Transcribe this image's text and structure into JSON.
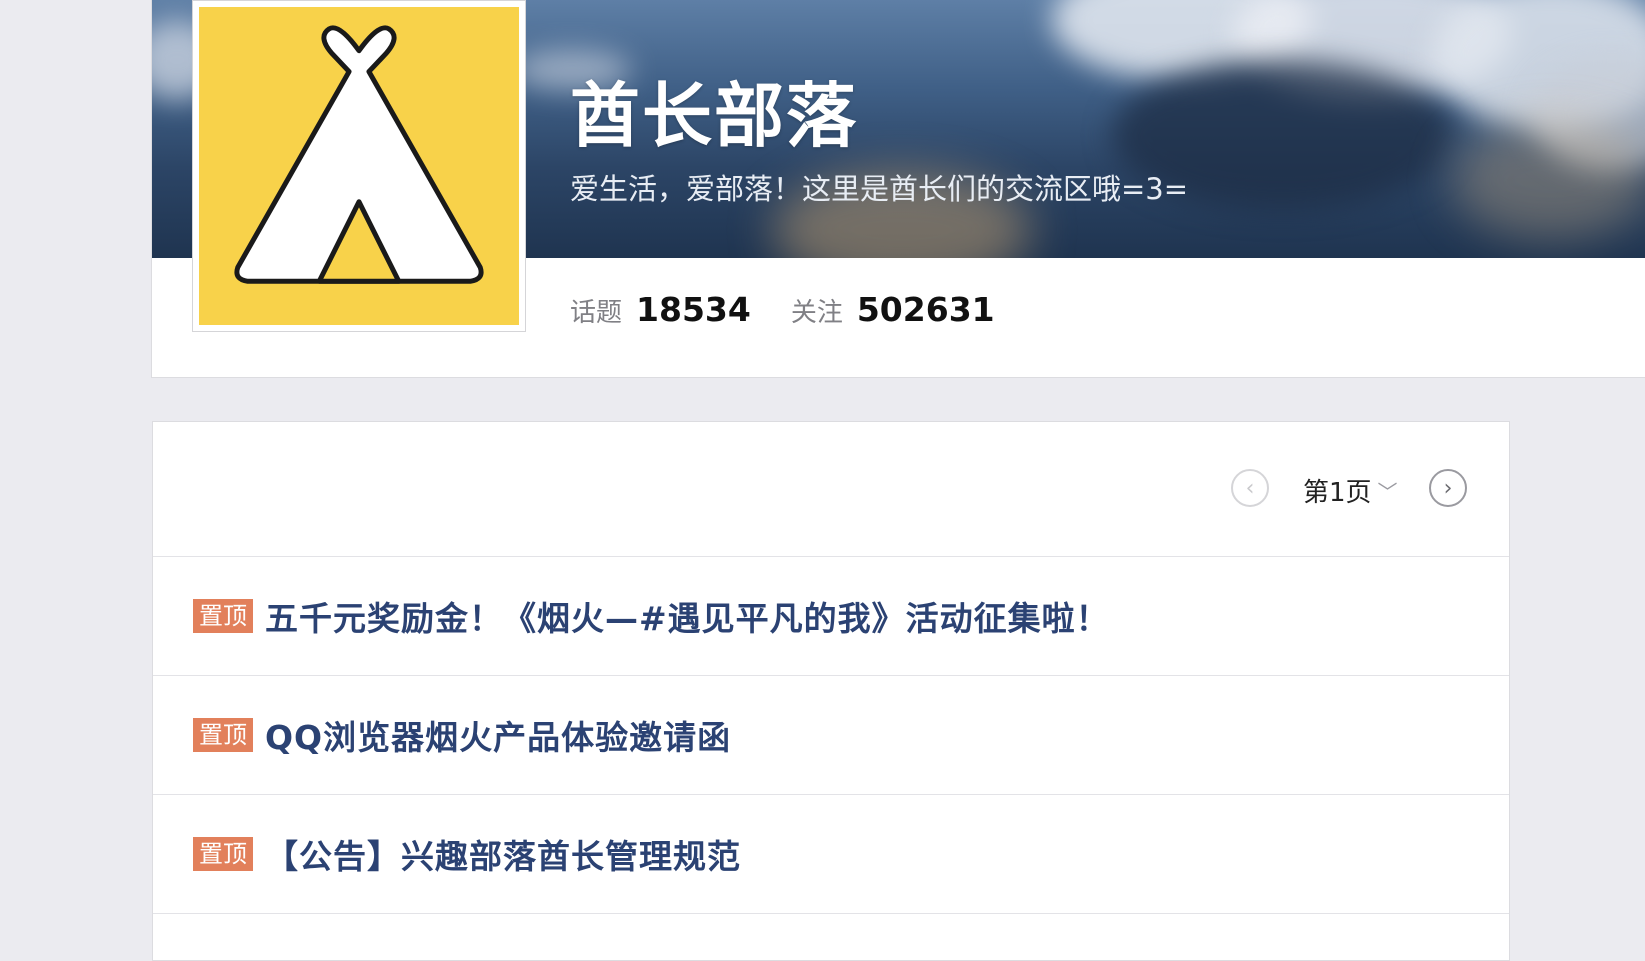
{
  "tribe": {
    "name": "酋长部落",
    "description": "爱生活，爱部落！这里是酋长们的交流区哦=3=",
    "stats": [
      {
        "label": "话题",
        "value": "18534"
      },
      {
        "label": "关注",
        "value": "502631"
      }
    ]
  },
  "pager": {
    "prev_icon": "chevron-left-circle-icon",
    "next_icon": "chevron-right-circle-icon",
    "current_page": "第1页",
    "dropdown_icon": "chevron-down-icon"
  },
  "topics": [
    {
      "badge": "置顶",
      "title": "五千元奖励金！《烟火—#遇见平凡的我》活动征集啦！"
    },
    {
      "badge": "置顶",
      "title": "QQ浏览器烟火产品体验邀请函"
    },
    {
      "badge": "置顶",
      "title": "【公告】兴趣部落酋长管理规范"
    }
  ],
  "colors": {
    "pin_badge": "#e2805b",
    "topic_title": "#2b4273",
    "avatar_bg": "#f8d24a",
    "page_bg": "#ebebf0"
  }
}
